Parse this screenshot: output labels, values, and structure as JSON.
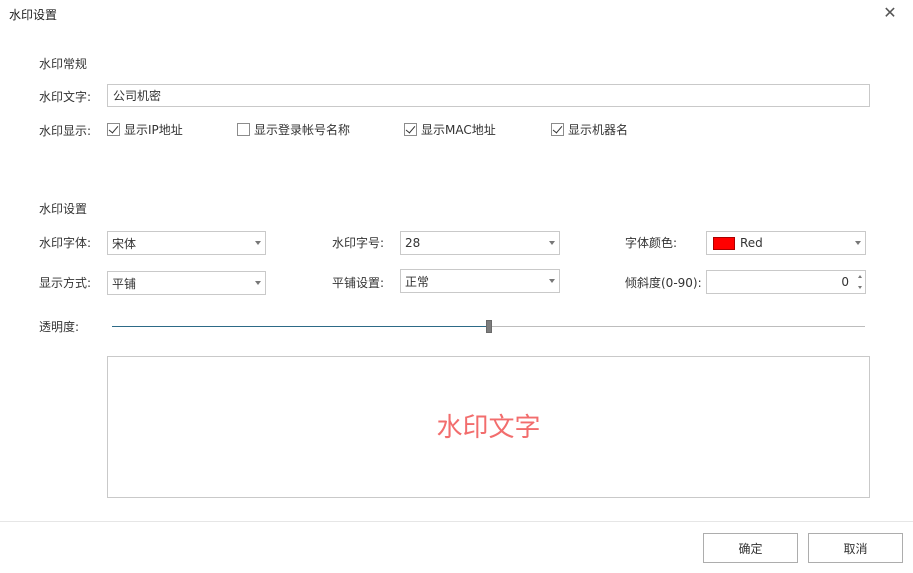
{
  "dialog": {
    "title": "水印设置",
    "close_glyph": "✕"
  },
  "general": {
    "section_title": "水印常规",
    "text_label": "水印文字:",
    "text_value": "公司机密",
    "display_label": "水印显示:",
    "options": [
      {
        "label": "显示IP地址",
        "checked": true
      },
      {
        "label": "显示登录帐号名称",
        "checked": false
      },
      {
        "label": "显示MAC地址",
        "checked": true
      },
      {
        "label": "显示机器名",
        "checked": true
      }
    ]
  },
  "settings": {
    "section_title": "水印设置",
    "font_label": "水印字体:",
    "font_value": "宋体",
    "size_label": "水印字号:",
    "size_value": "28",
    "color_label": "字体颜色:",
    "color_value": "Red",
    "color_hex": "#ff0000",
    "mode_label": "显示方式:",
    "mode_value": "平铺",
    "tile_label": "平铺设置:",
    "tile_value": "正常",
    "tilt_label": "倾斜度(0-90):",
    "tilt_value": "0",
    "opacity_label": "透明度:",
    "opacity_fraction": 0.5
  },
  "preview": {
    "text": "水印文字",
    "color": "#f26d6d"
  },
  "footer": {
    "ok_label": "确定",
    "cancel_label": "取消"
  }
}
